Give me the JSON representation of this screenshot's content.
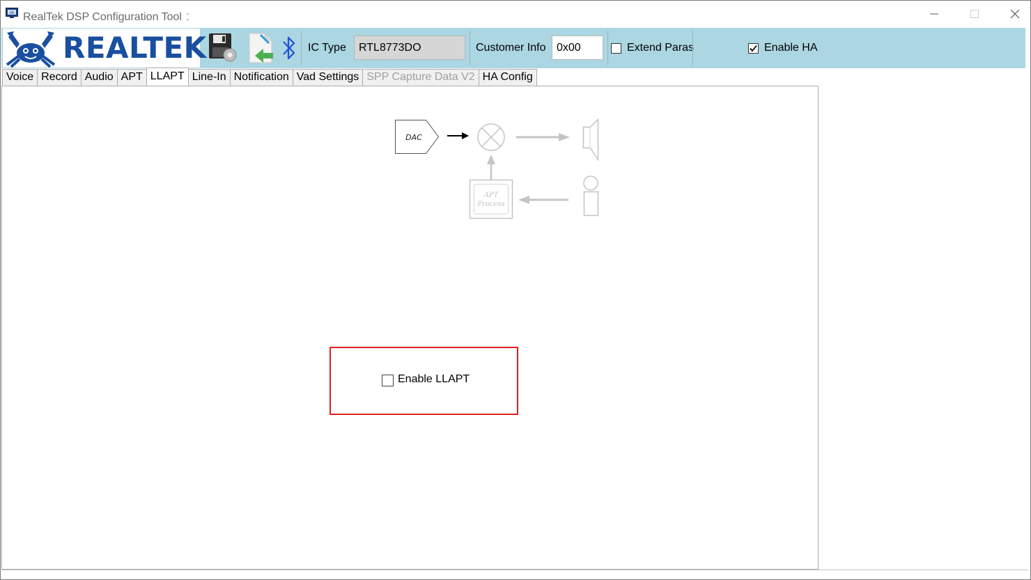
{
  "window": {
    "title": "RealTek DSP Configuration Tool",
    "title_suffix": "："
  },
  "toolbar": {
    "logo_text": "REALTEK",
    "ic_type_label": "IC Type",
    "ic_type_value": "RTL8773DO",
    "customer_info_label": "Customer Info",
    "customer_info_value": "0x00",
    "extend_paras_label": "Extend Paras",
    "extend_paras_checked": false,
    "enable_ha_label": "Enable HA",
    "enable_ha_checked": true
  },
  "tabs": [
    {
      "label": "Voice",
      "active": false,
      "disabled": false
    },
    {
      "label": "Record",
      "active": false,
      "disabled": false
    },
    {
      "label": "Audio",
      "active": false,
      "disabled": false
    },
    {
      "label": "APT",
      "active": false,
      "disabled": false
    },
    {
      "label": "LLAPT",
      "active": true,
      "disabled": false
    },
    {
      "label": "Line-In",
      "active": false,
      "disabled": false
    },
    {
      "label": "Notification",
      "active": false,
      "disabled": false
    },
    {
      "label": "Vad Settings",
      "active": false,
      "disabled": false
    },
    {
      "label": "SPP Capture Data V2",
      "active": false,
      "disabled": true
    },
    {
      "label": "HA Config",
      "active": false,
      "disabled": false
    }
  ],
  "diagram": {
    "dac_label": "DAC",
    "apt_process_line1": "APT",
    "apt_process_line2": "Process"
  },
  "llapt": {
    "enable_label": "Enable LLAPT",
    "enable_checked": false
  },
  "colors": {
    "toolbar_bg": "#abd6e2",
    "logo_blue": "#1a4fa0",
    "highlight_red": "#e02020",
    "disabled_gray": "#c0c0c0"
  }
}
